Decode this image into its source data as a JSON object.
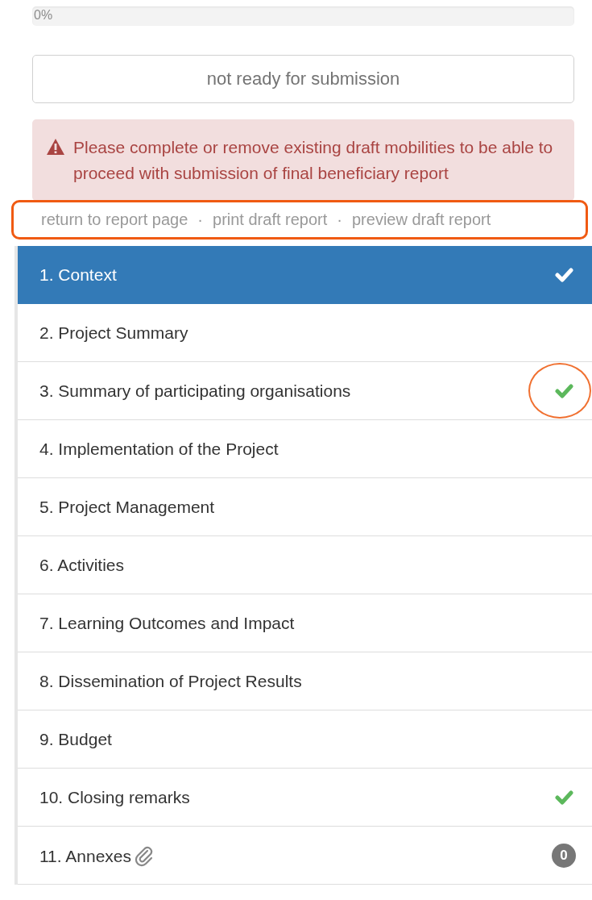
{
  "progress": {
    "label": "0%",
    "level": 0
  },
  "submit_button": {
    "label": "not ready for submission",
    "disabled": true
  },
  "alert": {
    "message": "Please complete or remove existing draft mobilities to be able to proceed with submission of final beneficiary report"
  },
  "links": {
    "highlighted": true,
    "separator": "·",
    "items": [
      {
        "label": "return to report page"
      },
      {
        "label": "print draft report"
      },
      {
        "label": "preview draft report"
      }
    ]
  },
  "sections": [
    {
      "label": "1. Context",
      "selected": true,
      "complete": true,
      "circled": false,
      "attachment": false
    },
    {
      "label": "2. Project Summary",
      "selected": false,
      "complete": false,
      "circled": false,
      "attachment": false
    },
    {
      "label": "3. Summary of participating organisations",
      "selected": false,
      "complete": true,
      "circled": true,
      "attachment": false
    },
    {
      "label": "4. Implementation of the Project",
      "selected": false,
      "complete": false,
      "circled": false,
      "attachment": false
    },
    {
      "label": "5. Project Management",
      "selected": false,
      "complete": false,
      "circled": false,
      "attachment": false
    },
    {
      "label": "6. Activities",
      "selected": false,
      "complete": false,
      "circled": false,
      "attachment": false
    },
    {
      "label": "7. Learning Outcomes and Impact",
      "selected": false,
      "complete": false,
      "circled": false,
      "attachment": false
    },
    {
      "label": "8. Dissemination of Project Results",
      "selected": false,
      "complete": false,
      "circled": false,
      "attachment": false
    },
    {
      "label": "9. Budget",
      "selected": false,
      "complete": false,
      "circled": false,
      "attachment": false
    },
    {
      "label": "10. Closing remarks",
      "selected": false,
      "complete": true,
      "circled": false,
      "attachment": false
    },
    {
      "label": "11. Annexes",
      "selected": false,
      "complete": false,
      "circled": false,
      "attachment": true,
      "badge": "0"
    }
  ]
}
